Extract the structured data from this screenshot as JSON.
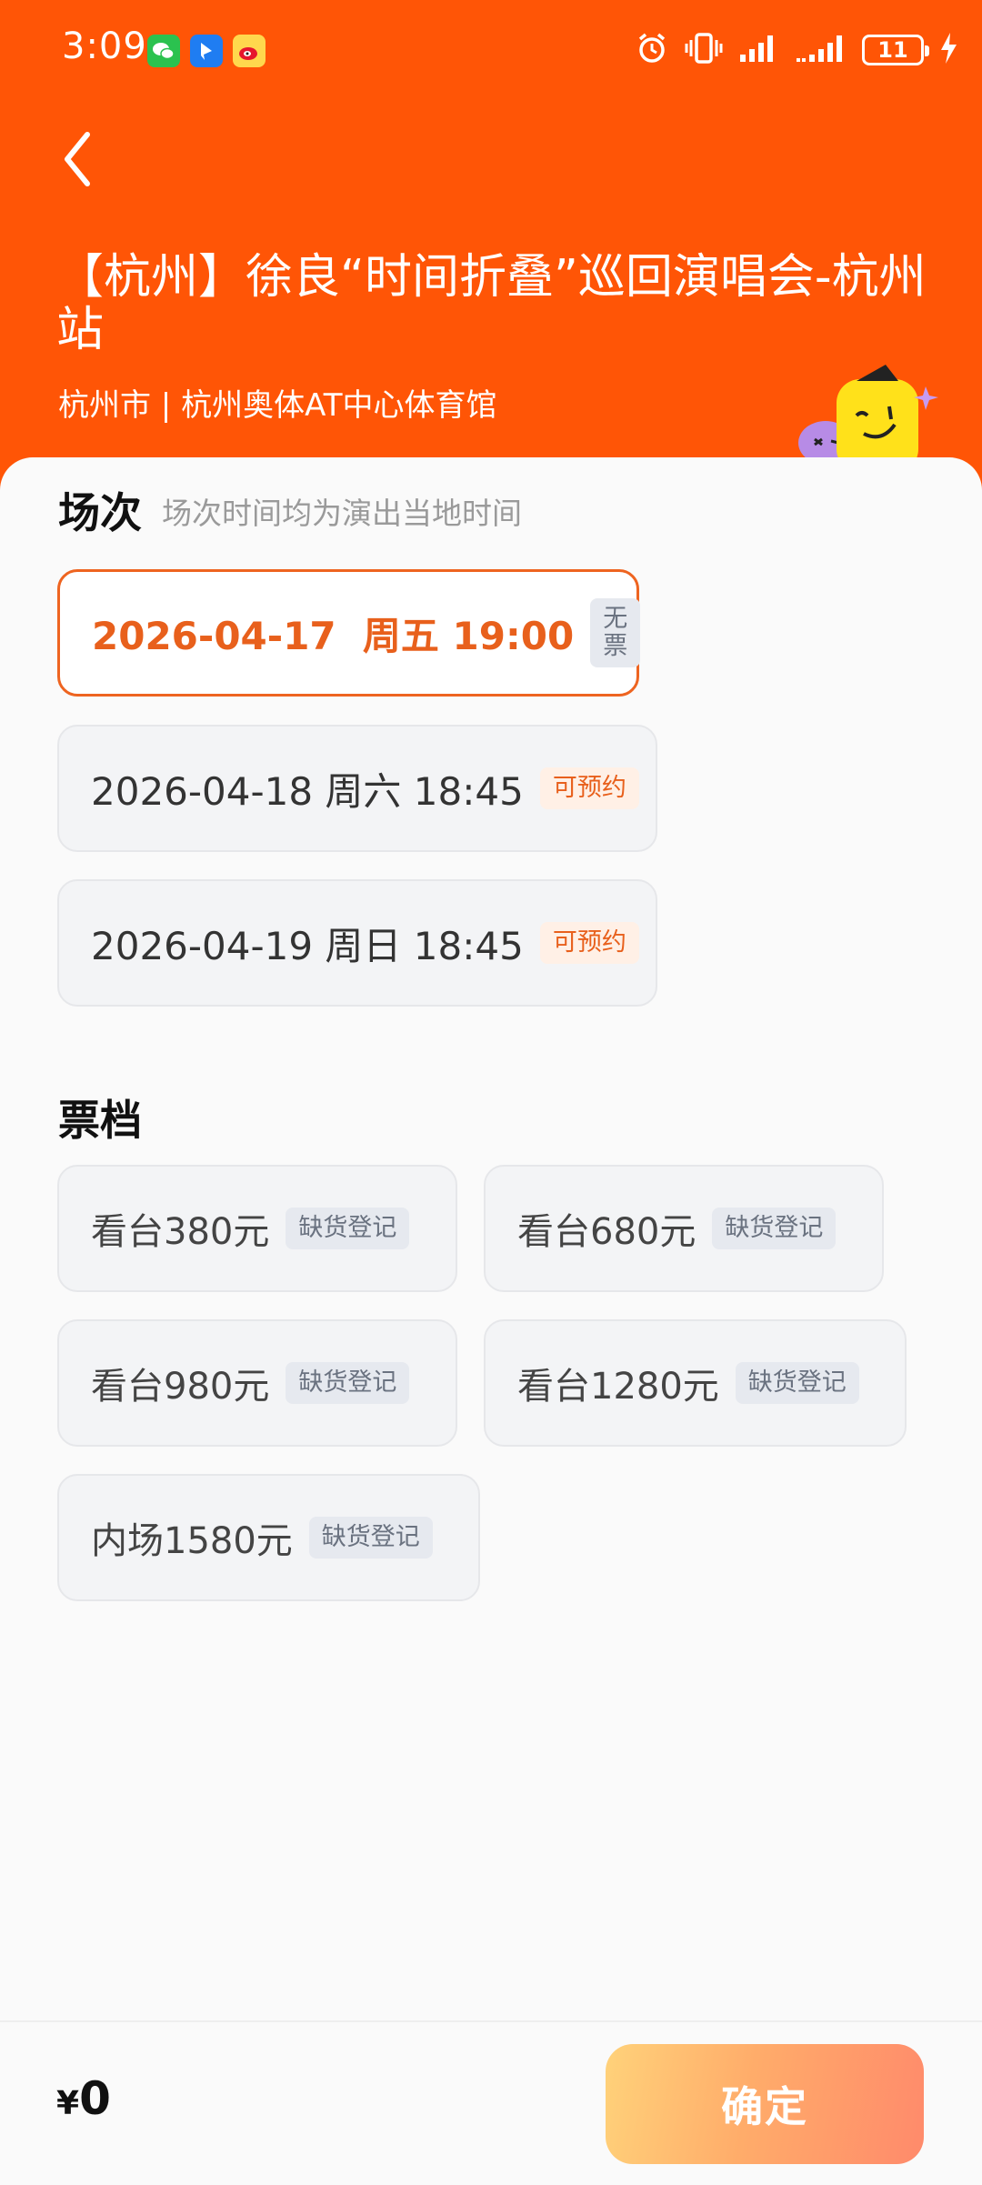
{
  "status_bar": {
    "time": "3:09",
    "battery": "11",
    "icons": [
      "wechat-icon",
      "app-icon",
      "weibo-icon",
      "alarm-icon",
      "vibrate-icon",
      "signal-icon",
      "signal-icon",
      "charging-icon"
    ]
  },
  "header": {
    "title": "【杭州】徐良“时间折叠”巡回演唱会-杭州站",
    "venue": "杭州市 | 杭州奥体AT中心体育馆",
    "accent_color": "#ff5506"
  },
  "sessions": {
    "title": "场次",
    "subtitle": "场次时间均为演出当地时间",
    "items": [
      {
        "label": "2026-04-17  周五 19:00",
        "tag": "无票"
      },
      {
        "label": "2026-04-18 周六 18:45",
        "tag": "可预约"
      },
      {
        "label": "2026-04-19 周日 18:45",
        "tag": "可预约"
      }
    ]
  },
  "tiers": {
    "title": "票档",
    "items": [
      {
        "label": "看台380元",
        "tag": "缺货登记"
      },
      {
        "label": "看台680元",
        "tag": "缺货登记"
      },
      {
        "label": "看台980元",
        "tag": "缺货登记"
      },
      {
        "label": "看台1280元",
        "tag": "缺货登记"
      },
      {
        "label": "内场1580元",
        "tag": "缺货登记"
      }
    ]
  },
  "footer": {
    "currency": "¥",
    "price": "0",
    "confirm_label": "确定"
  }
}
